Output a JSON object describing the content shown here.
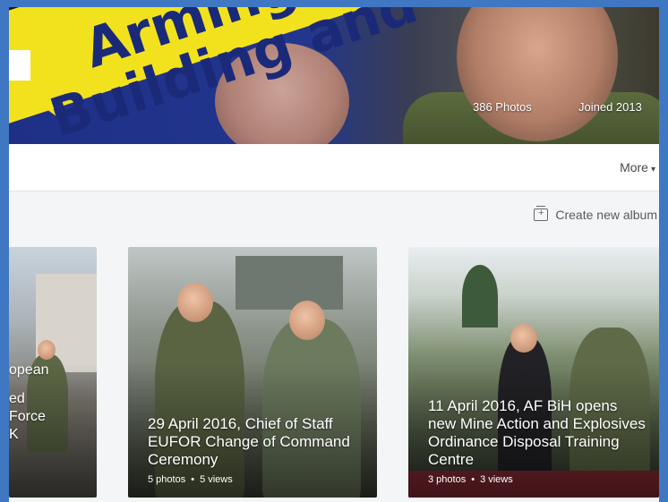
{
  "cover": {
    "banner_text_line1": "Arming",
    "banner_text_line2": "Building and",
    "photos_count": "386 Photos",
    "joined": "Joined 2013",
    "colors": {
      "tape": "#f2e21e",
      "tape_text": "#1b2a78",
      "page_border": "#3f77c2"
    }
  },
  "subnav": {
    "more_label": "More",
    "more_icon": "caret-down-icon"
  },
  "albums_toolbar": {
    "create_label": "Create new album",
    "create_icon": "album-add-icon"
  },
  "albums": [
    {
      "title_lines": [
        "opean",
        "ed",
        "Force",
        "K"
      ],
      "meta": ""
    },
    {
      "title": "29 April 2016, Chief of Staff EUFOR Change of Command Ceremony",
      "photos": "5 photos",
      "views": "5 views"
    },
    {
      "title": "11 April 2016, AF BiH opens new Mine Action and Explosives Ordinance Disposal Training Centre",
      "photos": "3 photos",
      "views": "3 views"
    }
  ]
}
